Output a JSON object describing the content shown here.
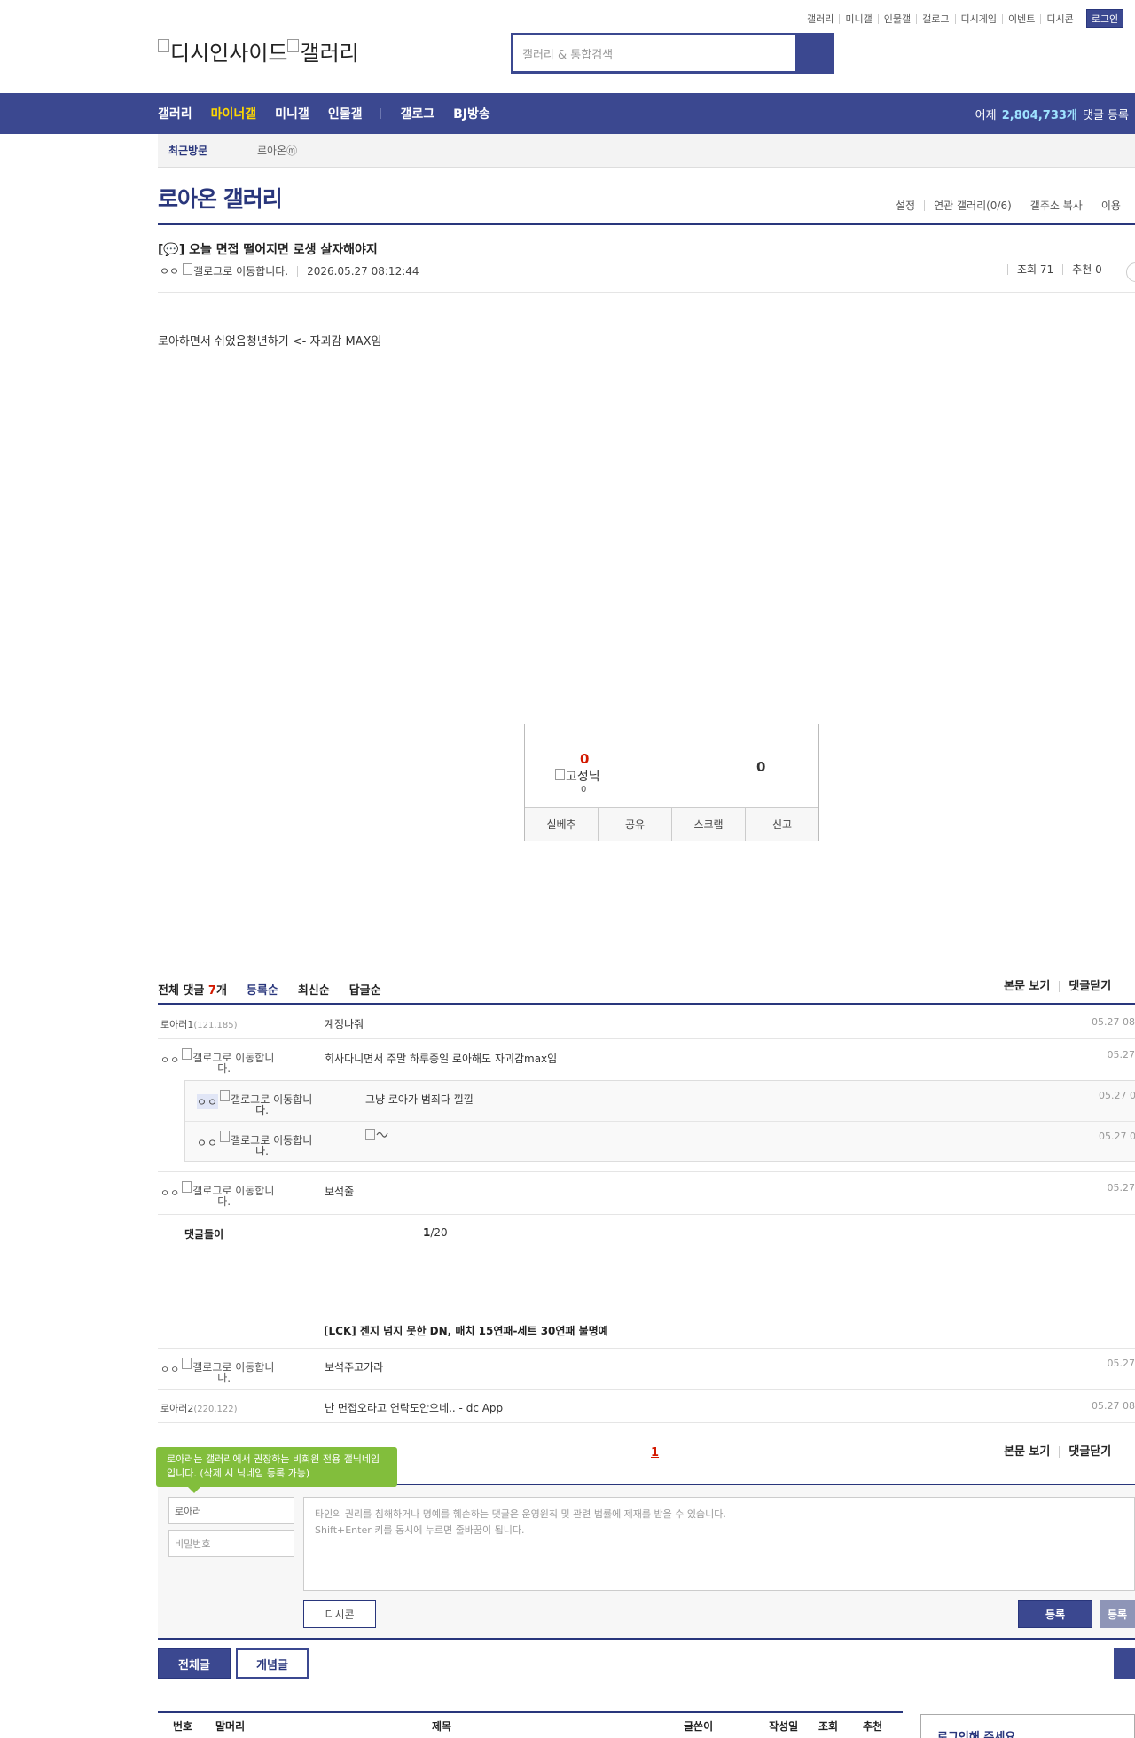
{
  "top_util": {
    "links": [
      "갤러리",
      "미니갤",
      "인물갤",
      "갤로그",
      "디시게임",
      "이벤트",
      "디시콘"
    ],
    "login": "로그인"
  },
  "logo": {
    "alt1": "디시인사이드",
    "alt2": "갤러리"
  },
  "search": {
    "placeholder": "갤러리 & 통합검색"
  },
  "gnb": {
    "menu": [
      "갤러리",
      "마이너갤",
      "미니갤",
      "인물갤",
      "갤로그",
      "BJ방송"
    ],
    "active_index": 1,
    "stat_prefix": "어제",
    "stat_value": "2,804,733개",
    "stat_suffix": "댓글 등록"
  },
  "recent_visit": {
    "label": "최근방문",
    "item": "로아온ⓜ"
  },
  "gallery": {
    "title": "로아온 갤러리",
    "links": [
      "설정",
      "연관 갤러리(0/6)",
      "갤주소 복사",
      "이용"
    ]
  },
  "post": {
    "title": "[💬] 오늘 면접 떨어지면 로생 살자해야지",
    "author_prefix": "ㅇㅇ",
    "author_alt": "갤로그로 이동합니다.",
    "date": "2026.05.27 08:12:44",
    "views": "조회 71",
    "recommend": "추천 0",
    "body": "로아하면서 쉬었음청년하기 <- 자괴감 MAX임"
  },
  "recommend_box": {
    "up_count": "0",
    "fixed_alt": "고정닉",
    "fixed_count": "0",
    "down_count": "0",
    "buttons": [
      "실베추",
      "공유",
      "스크랩",
      "신고"
    ]
  },
  "comments_header": {
    "total_prefix": "전체 댓글",
    "total_count": "7",
    "total_suffix": "개",
    "sorts": [
      "등록순",
      "최신순",
      "답글순"
    ],
    "actions": [
      "본문 보기",
      "댓글닫기"
    ]
  },
  "comments": {
    "c1": {
      "nick": "로아러1",
      "ip": "(121.185)",
      "text": "계정나줘",
      "date": "05.27 08"
    },
    "c2": {
      "nick_prefix": "ㅇㅇ",
      "nick_l1": "갤로그로 이동합니",
      "nick_l2": "다.",
      "text": "회사다니면서 주말 하루종일 로아해도 자괴감max임",
      "date": "05.27"
    },
    "r1": {
      "nick_prefix": "ㅇㅇ",
      "nick_l1": "갤로그로 이동합니",
      "nick_l2": "다.",
      "text": "그냥 로아가 범죄다 낄낄",
      "date": "05.27 0"
    },
    "r2": {
      "nick_prefix": "ㅇㅇ",
      "nick_l1": "갤로그로 이동합니",
      "nick_l2": "다.",
      "text": "",
      "date": "05.27 0"
    },
    "c3": {
      "nick_prefix": "ㅇㅇ",
      "nick_l1": "갤로그로 이동합니",
      "nick_l2": "다.",
      "text": "보석줄",
      "date": "05.27"
    },
    "bot_label": "댓글돌이",
    "page_current": "1",
    "page_total": "/20",
    "related_title": "[LCK] 젠지 넘지 못한 DN, 매치 15연패-세트 30연패 불명예",
    "c4": {
      "nick_prefix": "ㅇㅇ",
      "nick_l1": "갤로그로 이동합니",
      "nick_l2": "다.",
      "text": "보석주고가라",
      "date": "05.27"
    },
    "c5": {
      "nick": "로아러2",
      "ip": "(220.122)",
      "text": "난 면접오라고 연락도안오네.. - dc App",
      "date": "05.27 08"
    }
  },
  "pager": {
    "current": "1"
  },
  "write": {
    "tooltip": "로아러는 갤러리에서 권장하는 비회원 전용 갤닉네임입니다. (삭제 시 닉네임 등록 가능)",
    "nick_value": "로아러",
    "password_placeholder": "비밀번호",
    "textarea_line1": "타인의 권리를 침해하거나 명예를 훼손하는 댓글은 운영원칙 및 관련 법률에 제재를 받을 수 있습니다.",
    "textarea_line2": "Shift+Enter 키를 동시에 누르면 줄바꿈이 됩니다.",
    "dccon": "디시콘",
    "submit": "등록",
    "submit2": "등록"
  },
  "bottom": {
    "all_posts": "전체글",
    "concept_posts": "개념글",
    "list_head": [
      "번호",
      "말머리",
      "제목",
      "글쓴이",
      "작성일",
      "조회",
      "추천"
    ],
    "login_box": "로그인해 주세요"
  }
}
